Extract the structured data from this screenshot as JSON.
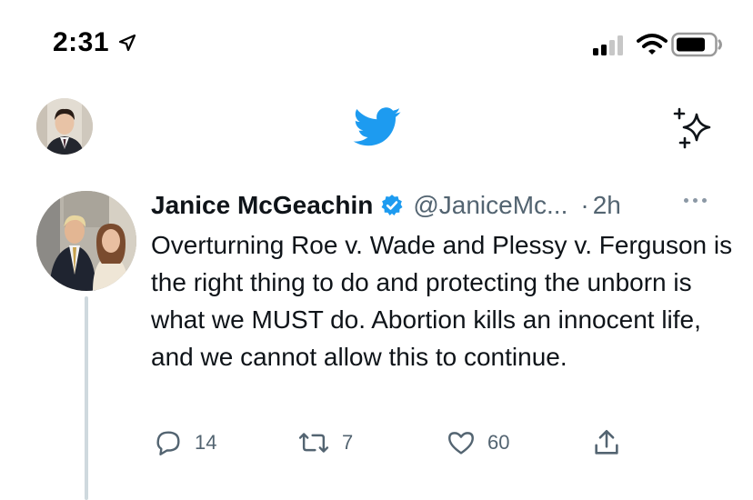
{
  "status_bar": {
    "time": "2:31"
  },
  "tweet": {
    "author_name": "Janice McGeachin",
    "handle": "@JaniceMc...",
    "dot": "·",
    "time": "2h",
    "text": "Overturning Roe v. Wade and Plessy v. Ferguson is the right thing to do and protecting the unborn is what we MUST do. Abortion kills an innocent life, and we cannot allow this to continue.",
    "actions": {
      "replies": "14",
      "retweets": "7",
      "likes": "60"
    }
  },
  "colors": {
    "twitter_blue": "#1d9bf0",
    "muted": "#536471",
    "text": "#0f1419",
    "thread_line": "#cfd9de"
  },
  "icons": [
    "location-arrow-icon",
    "signal-icon",
    "wifi-icon",
    "battery-icon",
    "twitter-bird-icon",
    "sparkle-icon",
    "verified-icon",
    "more-icon",
    "reply-icon",
    "retweet-icon",
    "like-icon",
    "share-icon"
  ]
}
